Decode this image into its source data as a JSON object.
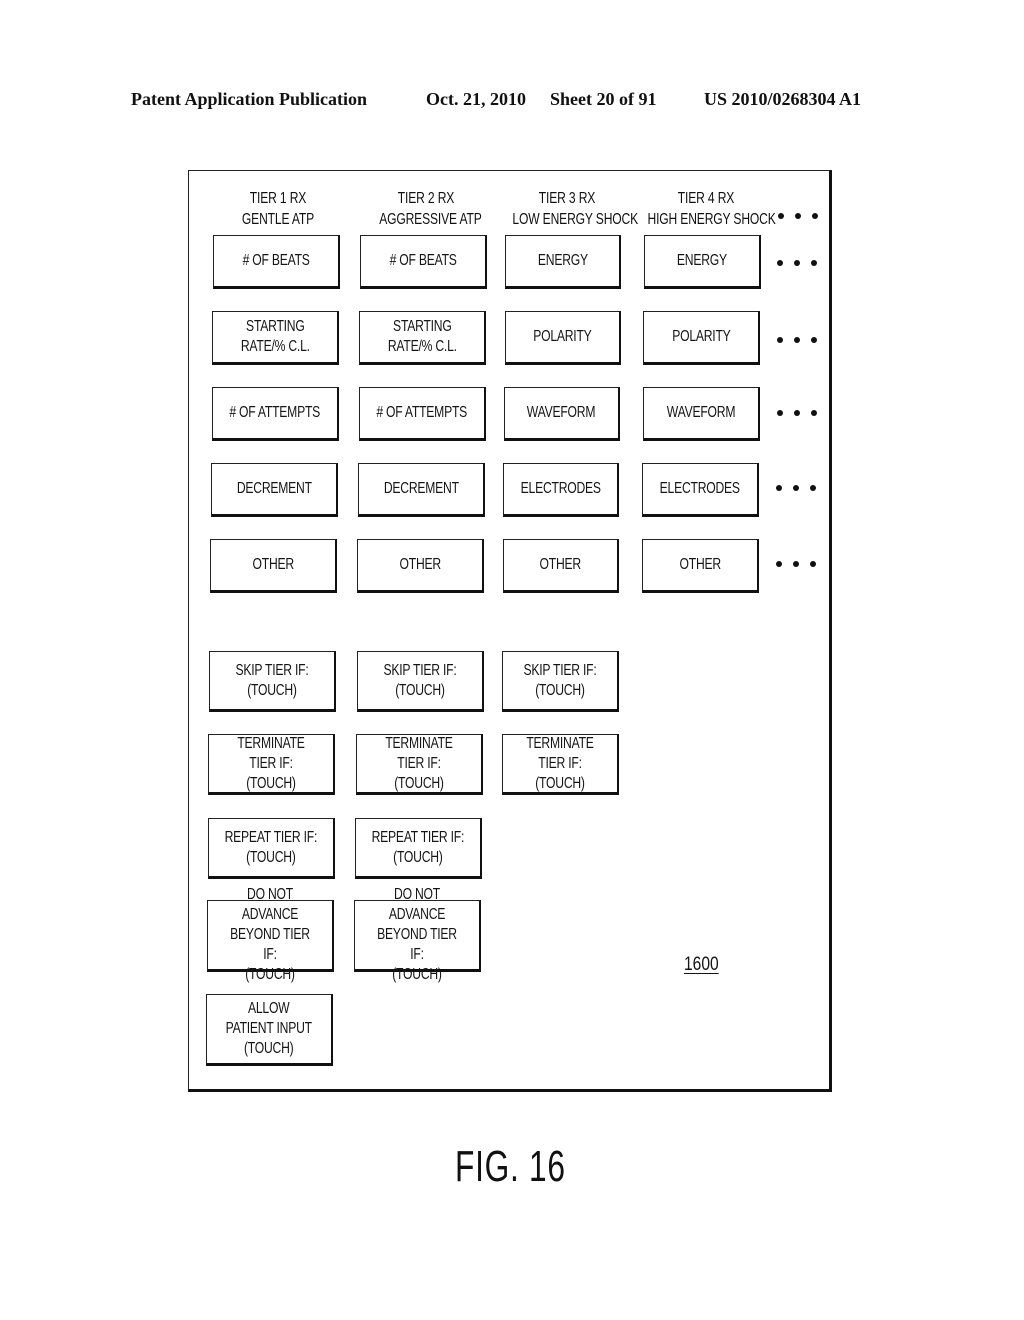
{
  "header": {
    "publication": "Patent Application Publication",
    "date": "Oct. 21, 2010",
    "sheet": "Sheet 20 of 91",
    "patent_number": "US 2010/0268304 A1"
  },
  "figure": {
    "reference_numeral": "1600",
    "label": "FIG. 16"
  },
  "tiers": [
    {
      "title": "TIER 1 RX",
      "subtitle": "GENTLE ATP",
      "parameters": [
        "# OF BEATS",
        "STARTING\nRATE/% C.L.",
        "# OF ATTEMPTS",
        "DECREMENT",
        "OTHER"
      ],
      "conditions": [
        "SKIP TIER IF:\n(TOUCH)",
        "TERMINATE TIER IF:\n(TOUCH)",
        "REPEAT TIER IF:\n(TOUCH)",
        "DO NOT ADVANCE\nBEYOND TIER IF:\n(TOUCH)",
        "ALLOW\nPATIENT INPUT\n(TOUCH)"
      ]
    },
    {
      "title": "TIER 2 RX",
      "subtitle": "AGGRESSIVE ATP",
      "parameters": [
        "# OF BEATS",
        "STARTING\nRATE/% C.L.",
        "# OF ATTEMPTS",
        "DECREMENT",
        "OTHER"
      ],
      "conditions": [
        "SKIP TIER IF:\n(TOUCH)",
        "TERMINATE TIER IF:\n(TOUCH)",
        "REPEAT TIER IF:\n(TOUCH)",
        "DO NOT ADVANCE\nBEYOND TIER IF:\n(TOUCH)"
      ]
    },
    {
      "title": "TIER 3 RX",
      "subtitle": "LOW ENERGY SHOCK",
      "parameters": [
        "ENERGY",
        "POLARITY",
        "WAVEFORM",
        "ELECTRODES",
        "OTHER"
      ],
      "conditions": [
        "SKIP TIER IF:\n(TOUCH)",
        "TERMINATE TIER IF:\n(TOUCH)"
      ]
    },
    {
      "title": "TIER 4 RX",
      "subtitle": "HIGH ENERGY SHOCK",
      "parameters": [
        "ENERGY",
        "POLARITY",
        "WAVEFORM",
        "ELECTRODES",
        "OTHER"
      ],
      "conditions": []
    }
  ],
  "continuation_icon": "ellipsis-icon"
}
